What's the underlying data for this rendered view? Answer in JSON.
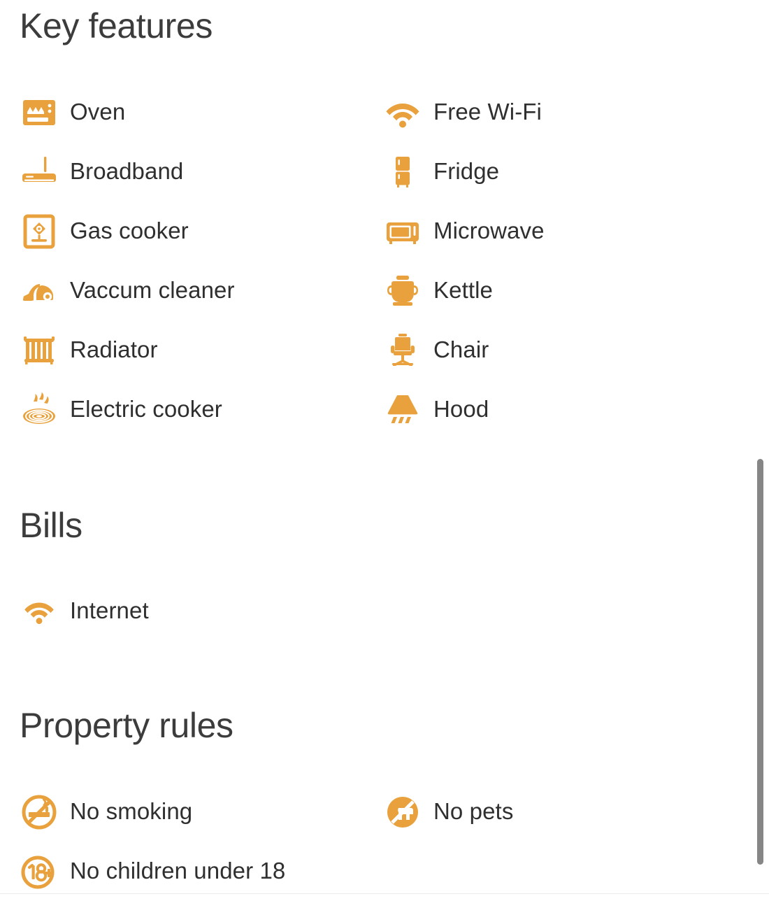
{
  "theme": {
    "accent_color": "#e8a13c",
    "heading_color": "#3c3c3c",
    "label_color": "#2f2f2f",
    "background_color": "#ffffff",
    "scrollbar_color": "#868686"
  },
  "sections": {
    "key_features": {
      "heading": "Key features",
      "items": [
        {
          "label": "Oven",
          "icon": "oven-icon"
        },
        {
          "label": "Free Wi-Fi",
          "icon": "wifi-icon"
        },
        {
          "label": "Broadband",
          "icon": "router-icon"
        },
        {
          "label": "Fridge",
          "icon": "fridge-icon"
        },
        {
          "label": "Gas cooker",
          "icon": "gas-cooker-icon"
        },
        {
          "label": "Microwave",
          "icon": "microwave-icon"
        },
        {
          "label": "Vaccum cleaner",
          "icon": "vacuum-cleaner-icon"
        },
        {
          "label": "Kettle",
          "icon": "kettle-icon"
        },
        {
          "label": "Radiator",
          "icon": "radiator-icon"
        },
        {
          "label": "Chair",
          "icon": "office-chair-icon"
        },
        {
          "label": "Electric cooker",
          "icon": "electric-hob-icon"
        },
        {
          "label": "Hood",
          "icon": "extractor-hood-icon"
        }
      ]
    },
    "bills": {
      "heading": "Bills",
      "items": [
        {
          "label": "Internet",
          "icon": "wifi-icon"
        }
      ]
    },
    "property_rules": {
      "heading": "Property rules",
      "items": [
        {
          "label": "No smoking",
          "icon": "no-smoking-icon"
        },
        {
          "label": "No pets",
          "icon": "no-pets-icon"
        },
        {
          "label": "No children under 18",
          "icon": "age-18-plus-icon"
        }
      ]
    }
  },
  "scrollbar": {
    "orientation": "vertical",
    "position_label": "scrolled"
  }
}
